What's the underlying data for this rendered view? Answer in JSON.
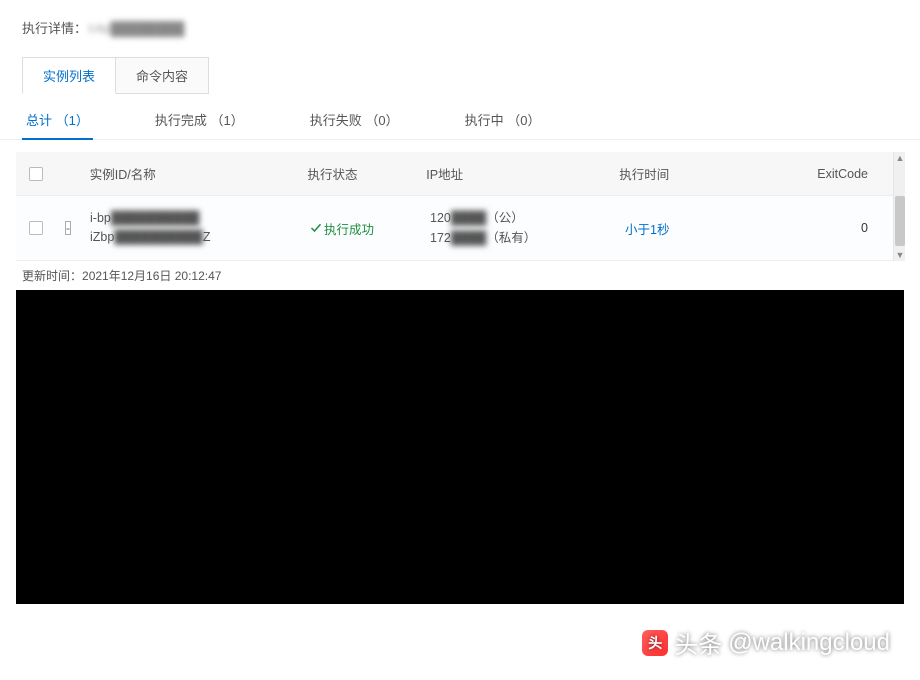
{
  "header": {
    "title_label": "执行详情：",
    "task_id": "t-hz████████"
  },
  "main_tabs": [
    {
      "label": "实例列表",
      "active": true
    },
    {
      "label": "命令内容",
      "active": false
    }
  ],
  "filter_tabs": [
    {
      "label": "总计",
      "count": "（1）",
      "active": true
    },
    {
      "label": "执行完成",
      "count": "（1）",
      "active": false
    },
    {
      "label": "执行失败",
      "count": "（0）",
      "active": false
    },
    {
      "label": "执行中",
      "count": "（0）",
      "active": false
    }
  ],
  "table": {
    "headers": {
      "instance": "实例ID/名称",
      "status": "执行状态",
      "ip": "IP地址",
      "time": "执行时间",
      "exitcode": "ExitCode"
    },
    "rows": [
      {
        "id_line1_prefix": "i-bp",
        "id_line1_blur": "██████████",
        "id_line2_prefix": "iZbp",
        "id_line2_blur": "██████████",
        "id_line2_suffix": "Z",
        "status_label": "执行成功",
        "ip_line1_prefix": "120",
        "ip_line1_blur": "████",
        "ip_line1_suffix": "（公）",
        "ip_line2_prefix": "172",
        "ip_line2_blur": "████",
        "ip_line2_suffix": "（私有）",
        "time_text": "小于1秒",
        "exitcode": "0"
      }
    ]
  },
  "update_time_label": "更新时间：",
  "update_time_value": "2021年12月16日 20:12:47",
  "watermark": {
    "prefix": "头条",
    "handle": "@walkingcloud"
  }
}
